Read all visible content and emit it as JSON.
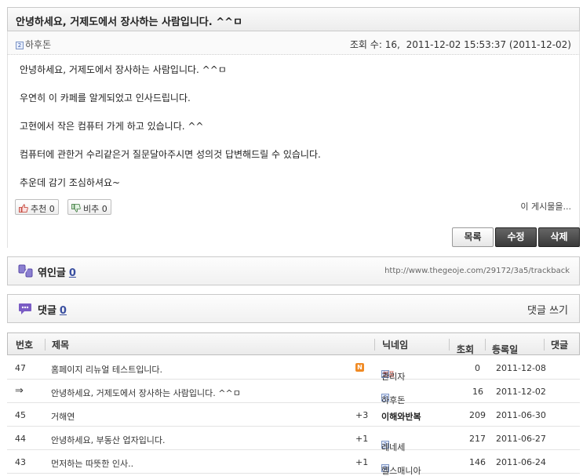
{
  "post": {
    "title": "안녕하세요, 거제도에서 장사하는 사람입니다. ^^ㅁ",
    "author_badge": "2",
    "author": "하후돈",
    "views_label": "조회 수:",
    "views": "16,",
    "datetime": "2011-12-02 15:53:37 (2011-12-02)",
    "body": [
      "안녕하세요, 거제도에서 장사하는 사람입니다. ^^ㅁ",
      "우연히 이 카페를 알게되었고 인사드립니다.",
      "고현에서 작은 컴퓨터 가게 하고 있습니다. ^^",
      "컴퓨터에 관한거 수리같은거 질문달아주시면 성의것 답변해드릴 수 있습니다.",
      "추운데 감기 조심하셔요~"
    ],
    "recommend_label": "추천 0",
    "oppose_label": "비추 0",
    "more_label": "이 게시물을..."
  },
  "actions": {
    "list": "목록",
    "edit": "수정",
    "delete": "삭제"
  },
  "trackback": {
    "label": "엮인글",
    "count": "0",
    "url": "http://www.thegeoje.com/29172/3a5/trackback"
  },
  "comments": {
    "label": "댓글",
    "count": "0",
    "write": "댓글 쓰기"
  },
  "list": {
    "headers": {
      "no": "번호",
      "title": "제목",
      "nick": "닉네임",
      "views": "조회",
      "date": "등록일",
      "comments": "댓글"
    },
    "rows": [
      {
        "no": "47",
        "title": "홈페이지 리뉴얼 테스트입니다.",
        "badge": "N",
        "plus": "",
        "nick": "관리자",
        "views": "0",
        "date": "2011-12-08"
      },
      {
        "no": "⇒",
        "title": "안녕하세요, 거제도에서 장사하는 사람입니다. ^^ㅁ",
        "badge": "",
        "plus": "",
        "nick": "하후돈",
        "views": "16",
        "date": "2011-12-02"
      },
      {
        "no": "45",
        "title": "거해연",
        "badge": "",
        "plus": "+3",
        "nick": "이해와반복",
        "views": "209",
        "date": "2011-06-30"
      },
      {
        "no": "44",
        "title": "안녕하세요, 부동산 업자입니다.",
        "badge": "",
        "plus": "+1",
        "nick": "레네세",
        "views": "217",
        "date": "2011-06-27"
      },
      {
        "no": "43",
        "title": "먼저하는 따뜻한 인사..",
        "badge": "",
        "plus": "+1",
        "nick": "헬스매니아",
        "views": "146",
        "date": "2011-06-24"
      }
    ],
    "manager_logo": "명품"
  },
  "colors": {
    "dark_button": "#3a3a3a",
    "link_blue": "#3a4fa0",
    "new_badge": "#f08a24",
    "comment_icon": "#7a5cc4"
  }
}
